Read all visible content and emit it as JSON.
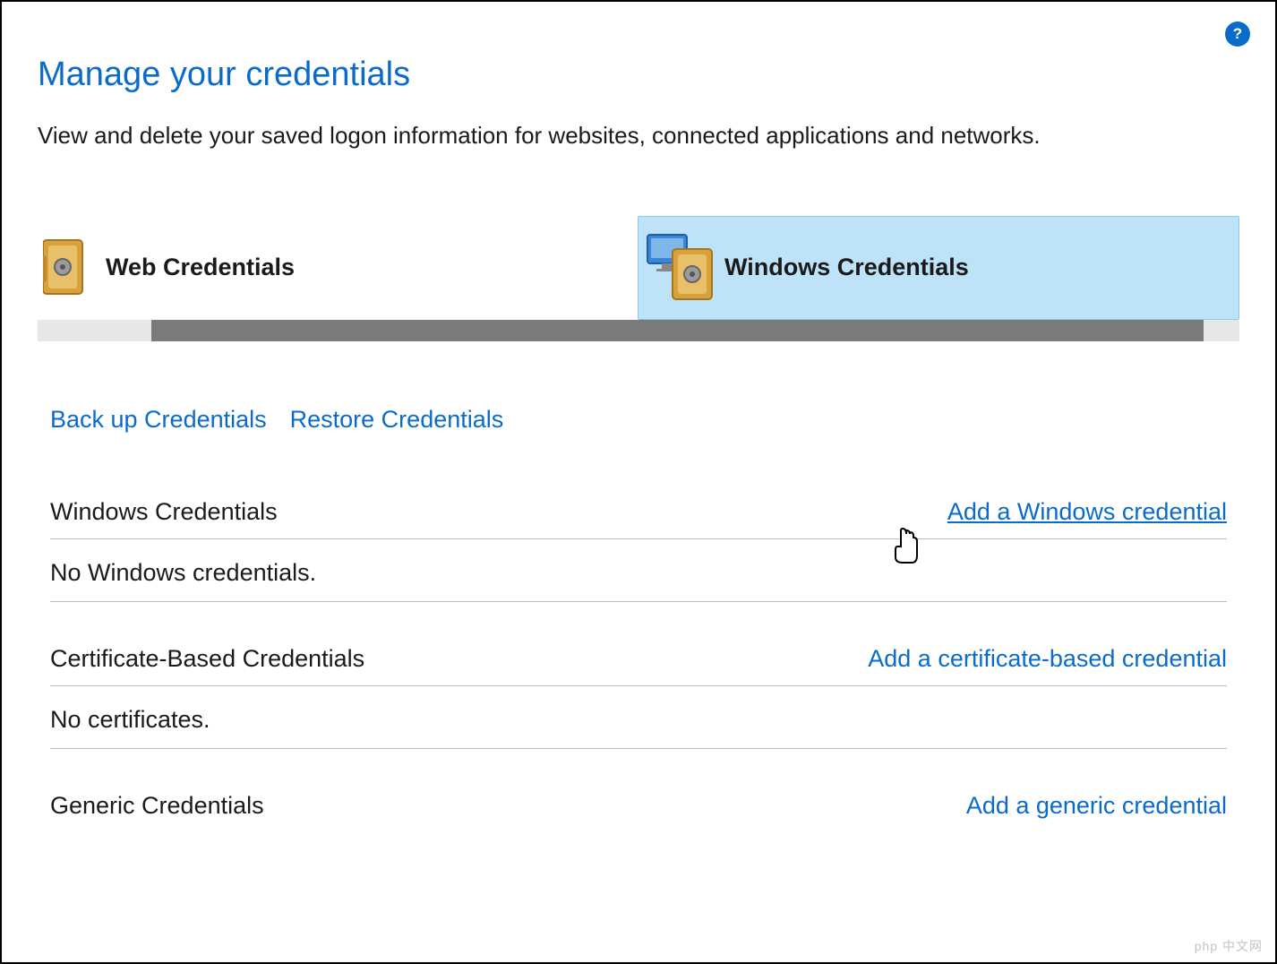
{
  "header": {
    "title": "Manage your credentials",
    "subtitle": "View and delete your saved logon information for websites, connected applications and networks.",
    "help_label": "?"
  },
  "tabs": {
    "web": {
      "label": "Web Credentials",
      "selected": false
    },
    "windows": {
      "label": "Windows Credentials",
      "selected": true
    }
  },
  "actions": {
    "backup": "Back up Credentials",
    "restore": "Restore Credentials"
  },
  "sections": [
    {
      "title": "Windows Credentials",
      "add_label": "Add a Windows credential",
      "empty_text": "No Windows credentials.",
      "add_hover": true
    },
    {
      "title": "Certificate-Based Credentials",
      "add_label": "Add a certificate-based credential",
      "empty_text": "No certificates.",
      "add_hover": false
    },
    {
      "title": "Generic Credentials",
      "add_label": "Add a generic credential",
      "empty_text": "",
      "add_hover": false
    }
  ],
  "watermark": "php 中文网"
}
